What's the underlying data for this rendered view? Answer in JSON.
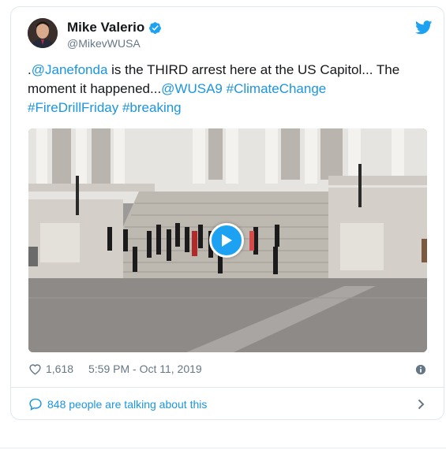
{
  "tweet": {
    "author": {
      "name": "Mike Valerio",
      "handle": "@MikevWUSA",
      "verified": true,
      "verified_icon": "verified-badge-icon",
      "avatar_icon": "avatar"
    },
    "brand_icon": "twitter-bird-icon",
    "text": {
      "prefix": ".",
      "mention1": "@Janefonda",
      "middle": " is the THIRD arrest here at the US Capitol... The moment it happened...",
      "mention2": "@WUSA9",
      "space1": " ",
      "hashtag1": "#ClimateChange",
      "hashtag2": "#FireDrillFriday",
      "space2": " ",
      "hashtag3": "#breaking"
    },
    "media": {
      "type": "video",
      "play_icon": "play-icon"
    },
    "likes": "1,618",
    "timestamp": "5:59 PM - Oct 11, 2019",
    "heart_icon": "heart-icon",
    "info_icon": "info-icon",
    "conversation": {
      "label": "848 people are talking about this",
      "icon": "comment-icon",
      "chevron_icon": "chevron-right-icon"
    },
    "colors": {
      "link": "#1b95e0",
      "accent": "#1da1f2",
      "secondary_text": "#657786",
      "border": "#e1e8ed"
    }
  }
}
